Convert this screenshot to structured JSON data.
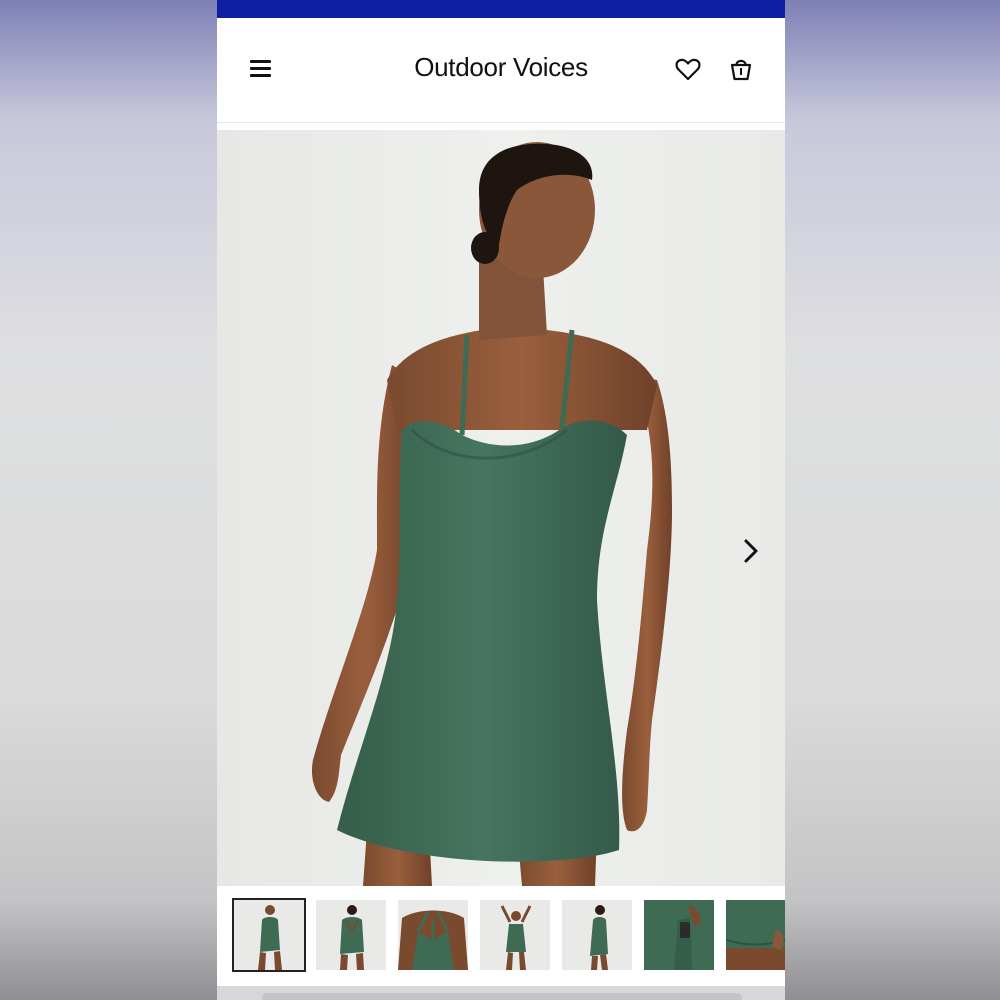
{
  "header": {
    "brand": "Outdoor Voices",
    "menu_icon": "hamburger-menu-icon",
    "wishlist_icon": "heart-icon",
    "bag_icon": "shopping-bag-icon"
  },
  "gallery": {
    "main_image": "model-in-green-exercise-dress",
    "next_icon": "chevron-right-icon",
    "thumbnails": [
      {
        "name": "thumb-front-full",
        "active": true
      },
      {
        "name": "thumb-back-full",
        "active": false
      },
      {
        "name": "thumb-back-straps-closeup",
        "active": false
      },
      {
        "name": "thumb-arms-raised",
        "active": false
      },
      {
        "name": "thumb-side-view",
        "active": false
      },
      {
        "name": "thumb-pocket-detail",
        "active": false
      },
      {
        "name": "thumb-hem-detail",
        "active": false
      }
    ]
  },
  "colors": {
    "top_bar": "#0f1ea4",
    "dress_green": "#3f6b55",
    "background": "#ffffff"
  }
}
